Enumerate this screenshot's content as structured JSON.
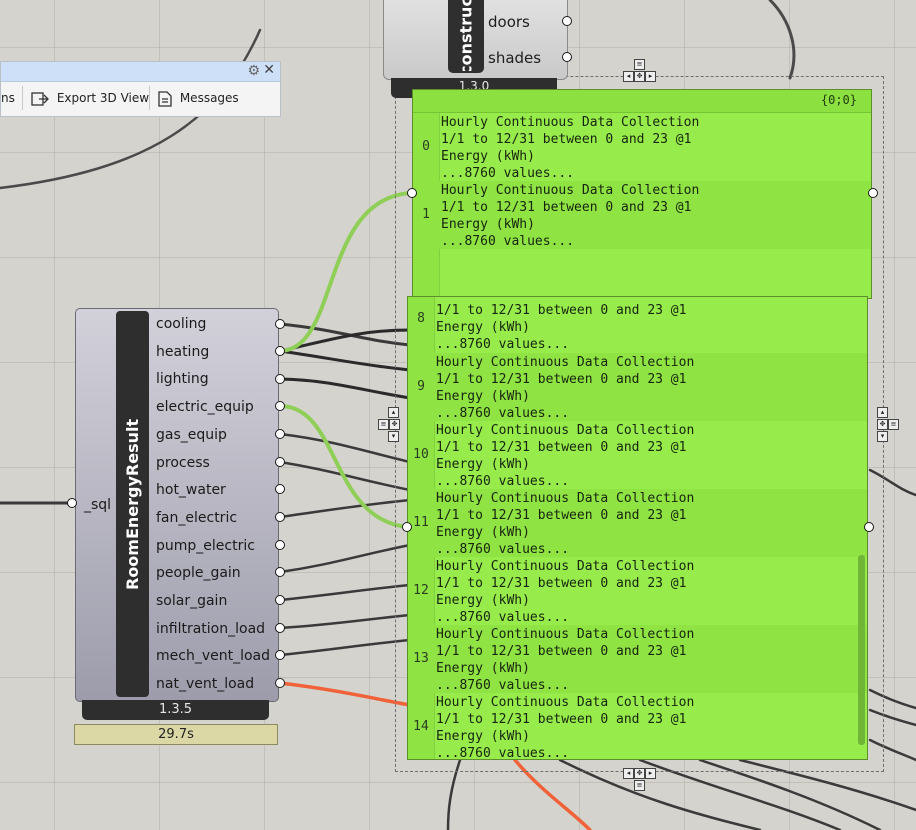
{
  "deconstruct": {
    "title": "Deconstruct",
    "outputs": [
      "doors",
      "shades"
    ],
    "version": "1.3.0"
  },
  "toolbar": {
    "items": [
      "ns",
      "Export 3D View",
      "Messages"
    ]
  },
  "room_energy_result": {
    "title": "RoomEnergyResult",
    "input": "_sql",
    "outputs": [
      "cooling",
      "heating",
      "lighting",
      "electric_equip",
      "gas_equip",
      "process",
      "hot_water",
      "fan_electric",
      "pump_electric",
      "people_gain",
      "solar_gain",
      "infiltration_load",
      "mech_vent_load",
      "nat_vent_load"
    ],
    "version": "1.3.5",
    "runtime": "29.7s"
  },
  "panel_top": {
    "path": "{0;0}",
    "rows": [
      {
        "index": "0",
        "lines": [
          "Hourly Continuous Data Collection",
          "1/1 to 12/31 between 0 and 23 @1",
          "Energy (kWh)",
          "...8760 values..."
        ]
      },
      {
        "index": "1",
        "lines": [
          "Hourly Continuous Data Collection",
          "1/1 to 12/31 between 0 and 23 @1",
          "Energy (kWh)",
          "...8760 values..."
        ]
      }
    ]
  },
  "panel_bottom": {
    "rows": [
      {
        "index": "8",
        "lines": [
          "1/1 to 12/31 between 0 and 23 @1",
          "Energy (kWh)",
          "...8760 values..."
        ]
      },
      {
        "index": "9",
        "lines": [
          "Hourly Continuous Data Collection",
          "1/1 to 12/31 between 0 and 23 @1",
          "Energy (kWh)",
          "...8760 values..."
        ]
      },
      {
        "index": "10",
        "lines": [
          "Hourly Continuous Data Collection",
          "1/1 to 12/31 between 0 and 23 @1",
          "Energy (kWh)",
          "...8760 values..."
        ]
      },
      {
        "index": "11",
        "lines": [
          "Hourly Continuous Data Collection",
          "1/1 to 12/31 between 0 and 23 @1",
          "Energy (kWh)",
          "...8760 values..."
        ]
      },
      {
        "index": "12",
        "lines": [
          "Hourly Continuous Data Collection",
          "1/1 to 12/31 between 0 and 23 @1",
          "Energy (kWh)",
          "...8760 values..."
        ]
      },
      {
        "index": "13",
        "lines": [
          "Hourly Continuous Data Collection",
          "1/1 to 12/31 between 0 and 23 @1",
          "Energy (kWh)",
          "...8760 values..."
        ]
      },
      {
        "index": "14",
        "lines": [
          "Hourly Continuous Data Collection",
          "1/1 to 12/31 between 0 and 23 @1",
          "Energy (kWh)",
          "...8760 values..."
        ]
      }
    ]
  },
  "colors": {
    "canvas": "#d5d3cd",
    "panel": "#97ec4b",
    "wire_selected": "#8fcf58",
    "wire_dark": "#3a3a3a",
    "wire_orange": "#f0623a"
  }
}
